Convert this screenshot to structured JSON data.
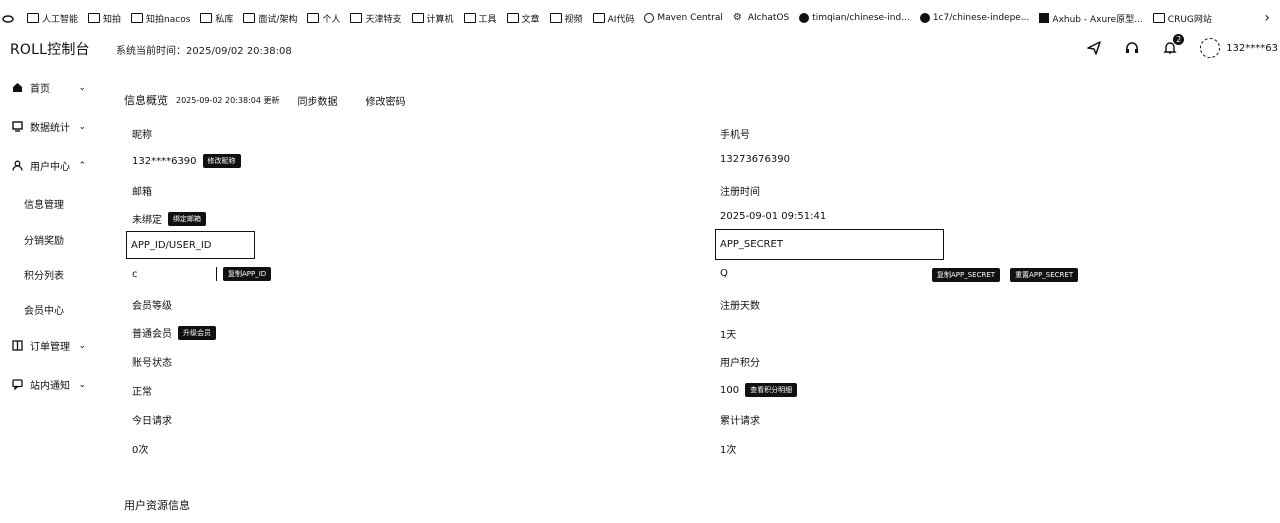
{
  "bookmarks": [
    {
      "label": "",
      "icon": "cloud-icon"
    },
    {
      "label": "人工智能",
      "icon": "folder-icon"
    },
    {
      "label": "知拍",
      "icon": "folder-icon"
    },
    {
      "label": "知拍nacos",
      "icon": "folder-icon"
    },
    {
      "label": "私库",
      "icon": "folder-icon"
    },
    {
      "label": "面试/架构",
      "icon": "folder-icon"
    },
    {
      "label": "个人",
      "icon": "folder-icon"
    },
    {
      "label": "天津特支",
      "icon": "folder-icon"
    },
    {
      "label": "计算机",
      "icon": "folder-icon"
    },
    {
      "label": "工具",
      "icon": "folder-icon"
    },
    {
      "label": "文章",
      "icon": "folder-icon"
    },
    {
      "label": "视频",
      "icon": "folder-icon"
    },
    {
      "label": "AI代码",
      "icon": "folder-icon"
    },
    {
      "label": "Maven Central",
      "icon": "maven-icon"
    },
    {
      "label": "AIchatOS",
      "icon": "gear-icon"
    },
    {
      "label": "timqian/chinese-ind...",
      "icon": "github-icon"
    },
    {
      "label": "1c7/chinese-indepe...",
      "icon": "github-icon"
    },
    {
      "label": "Axhub - Axure原型...",
      "icon": "axhub-icon"
    },
    {
      "label": "CRUG网站",
      "icon": "folder-icon"
    }
  ],
  "header": {
    "logo": "ROLL控制台",
    "system_time": "系统当前时间：2025/09/02 20:38:08",
    "notification_count": "2",
    "user_name": "132****63"
  },
  "sidebar": {
    "items": [
      {
        "label": "首页",
        "icon": "home-icon"
      },
      {
        "label": "数据统计",
        "icon": "chart-icon"
      },
      {
        "label": "用户中心",
        "icon": "user-icon"
      },
      {
        "label": "订单管理",
        "icon": "book-icon"
      },
      {
        "label": "站内通知",
        "icon": "message-icon"
      }
    ],
    "sub_items": [
      "信息管理",
      "分销奖励",
      "积分列表",
      "会员中心"
    ]
  },
  "overview": {
    "title": "信息概览",
    "subtitle": "2025-09-02 20:38:04 更新",
    "sync_label": "同步数据",
    "change_pwd_label": "修改密码"
  },
  "fields": {
    "account_label": "昵称",
    "account_value": "132****6390",
    "account_tag": "修改昵称",
    "phone_label": "手机号",
    "phone_value": "13273676390",
    "email_label": "邮箱",
    "email_value": "未绑定",
    "email_tag": "绑定邮箱",
    "reg_time_label": "注册时间",
    "reg_time_value": "2025-09-01 09:51:41",
    "app_id_label": "APP_ID/USER_ID",
    "app_id_value": "c",
    "app_id_tag": "复制APP_ID",
    "app_secret_label": "APP_SECRET",
    "app_secret_value": "Q",
    "copy_secret_tag": "复制APP_SECRET",
    "reset_secret_tag": "重置APP_SECRET",
    "member_level_label": "会员等级",
    "member_level_value": "普通会员",
    "member_level_tag": "升级会员",
    "reg_days_label": "注册天数",
    "reg_days_value": "1天",
    "status_label": "账号状态",
    "status_value": "正常",
    "points_label": "用户积分",
    "points_value": "100",
    "points_tag": "查看积分明细",
    "today_req_label": "今日请求",
    "today_req_value": "0次",
    "total_req_label": "累计请求",
    "total_req_value": "1次"
  },
  "resources_title": "用户资源信息"
}
